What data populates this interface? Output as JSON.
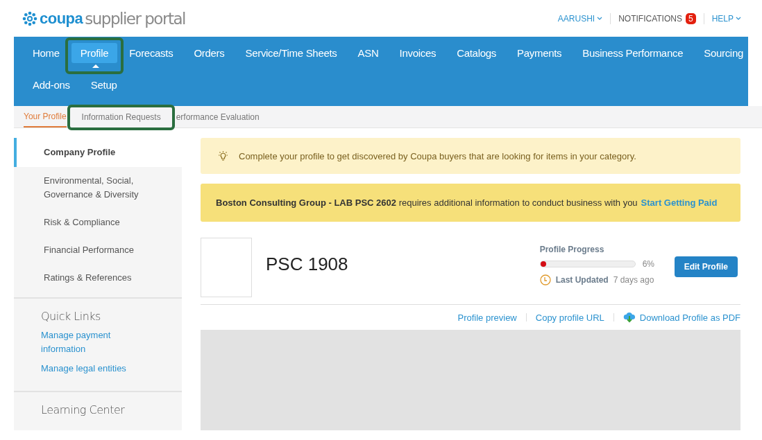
{
  "header": {
    "logo_mark": "coupa",
    "logo_text": "supplier portal",
    "user": "AARUSHI",
    "notifications": {
      "label": "NOTIFICATIONS",
      "count": "5"
    },
    "help": "HELP"
  },
  "nav": {
    "rows": [
      [
        {
          "label": "Home",
          "selected": false,
          "highlighted": false
        },
        {
          "label": "Profile",
          "selected": true,
          "highlighted": true
        },
        {
          "label": "Forecasts",
          "selected": false,
          "highlighted": false
        },
        {
          "label": "Orders",
          "selected": false,
          "highlighted": false
        },
        {
          "label": "Service/Time Sheets",
          "selected": false,
          "highlighted": false
        },
        {
          "label": "ASN",
          "selected": false,
          "highlighted": false
        },
        {
          "label": "Invoices",
          "selected": false,
          "highlighted": false
        },
        {
          "label": "Catalogs",
          "selected": false,
          "highlighted": false
        },
        {
          "label": "Payments",
          "selected": false,
          "highlighted": false
        },
        {
          "label": "Business Performance",
          "selected": false,
          "highlighted": false
        },
        {
          "label": "Sourcing",
          "selected": false,
          "highlighted": false
        }
      ],
      [
        {
          "label": "Add-ons",
          "selected": false,
          "highlighted": false
        },
        {
          "label": "Setup",
          "selected": false,
          "highlighted": false
        }
      ]
    ]
  },
  "subnav": [
    {
      "label": "Your Profile",
      "selected": true,
      "highlighted": false
    },
    {
      "label": "Information Requests",
      "selected": false,
      "highlighted": true
    },
    {
      "label": "erformance Evaluation",
      "selected": false,
      "highlighted": false
    }
  ],
  "sidebar": {
    "items": [
      {
        "label": "Company Profile",
        "selected": true
      },
      {
        "label": "Environmental, Social, Governance & Diversity",
        "selected": false
      },
      {
        "label": "Risk & Compliance",
        "selected": false
      },
      {
        "label": "Financial Performance",
        "selected": false
      },
      {
        "label": "Ratings & References",
        "selected": false
      }
    ],
    "quick_links": {
      "title": "Quick Links",
      "links": [
        "Manage payment information",
        "Manage legal entities"
      ]
    },
    "learning_center": {
      "title": "Learning Center"
    }
  },
  "banners": [
    {
      "kind": "tip",
      "text": "Complete your profile to get discovered by Coupa buyers that are looking for items in your category."
    },
    {
      "kind": "alert",
      "text": "**Boston Consulting Group - LAB PSC 2602** requires additional information to conduct business with you",
      "link": "Start Getting Paid"
    }
  ],
  "profile": {
    "name": "PSC 1908",
    "progress": {
      "title": "Profile Progress",
      "level": 0.06,
      "reading": "6%"
    },
    "last_updated": {
      "label": "Last Updated",
      "value": "7 days ago"
    },
    "edit_button": "Edit Profile",
    "actions": [
      {
        "kind": "link",
        "label": "Profile preview"
      },
      {
        "kind": "link",
        "label": "Copy profile URL"
      },
      {
        "kind": "download",
        "label": "Download Profile as PDF"
      }
    ]
  }
}
